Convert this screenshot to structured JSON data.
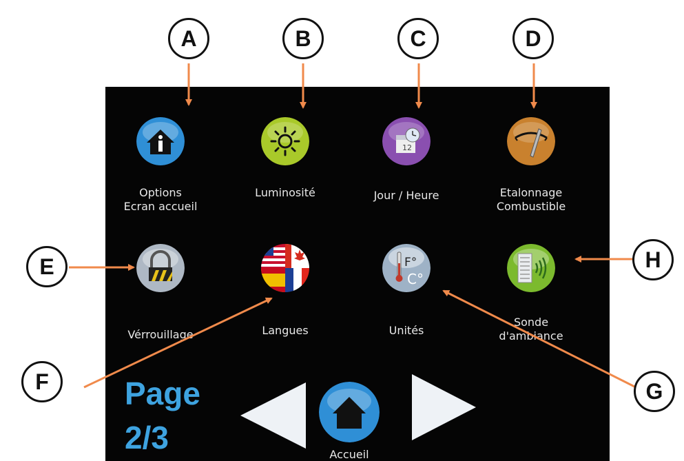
{
  "menu": {
    "options_accueil": {
      "line1": "Options",
      "line2": "Ecran accueil",
      "icon": "home-info-icon",
      "color": "#2f8fd6"
    },
    "luminosite": {
      "label": "Luminosité",
      "icon": "sun-icon",
      "color": "#a9c92a"
    },
    "jour_heure": {
      "label": "Jour / Heure",
      "icon": "calendar-clock-icon",
      "color": "#8a4fb0"
    },
    "etalonnage": {
      "line1": "Etalonnage",
      "line2": "Combustible",
      "icon": "gauge-icon",
      "color": "#c9812e"
    },
    "verrouillage": {
      "label": "Vérrouillage",
      "icon": "padlock-icon",
      "color": "#aeb8c4"
    },
    "langues": {
      "label": "Langues",
      "icon": "flags-icon"
    },
    "unites": {
      "label": "Unités",
      "icon": "thermometer-icon",
      "symbol_f": "F°",
      "symbol_c": "C°"
    },
    "sonde": {
      "line1": "Sonde",
      "line2": "d'ambiance",
      "icon": "sensor-icon",
      "color": "#7cba2e"
    }
  },
  "footer": {
    "page_word": "Page",
    "page_number": "2/3",
    "home_label": "Accueil"
  },
  "callouts": {
    "a": "A",
    "b": "B",
    "c": "C",
    "d": "D",
    "e": "E",
    "f": "F",
    "g": "G",
    "h": "H"
  },
  "colors": {
    "screen_bg": "#050505",
    "arrow": "#f08a4b",
    "page_text": "#3ea3e0"
  }
}
